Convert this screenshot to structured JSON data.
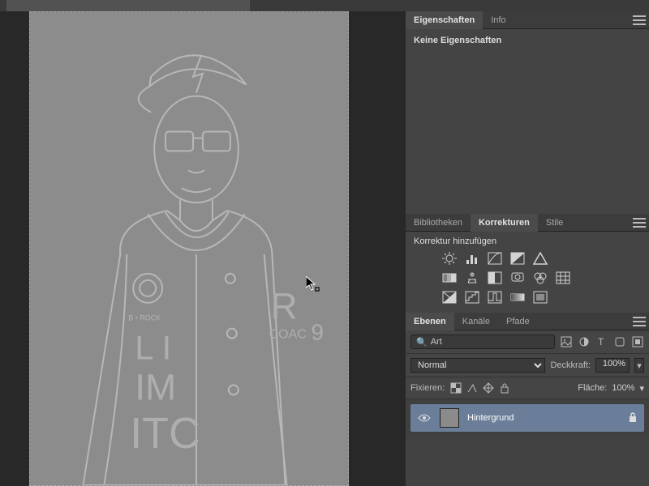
{
  "properties_panel": {
    "tabs": {
      "properties": "Eigenschaften",
      "info": "Info"
    },
    "no_properties": "Keine Eigenschaften"
  },
  "adjustments_panel": {
    "tabs": {
      "libraries": "Bibliotheken",
      "adjustments": "Korrekturen",
      "styles": "Stile"
    },
    "add_adjustment": "Korrektur hinzufügen"
  },
  "layers_panel": {
    "tabs": {
      "layers": "Ebenen",
      "channels": "Kanäle",
      "paths": "Pfade"
    },
    "filter_label": "Art",
    "blend_mode": "Normal",
    "opacity_label": "Deckkraft:",
    "opacity_value": "100%",
    "lock_label": "Fixieren:",
    "fill_label": "Fläche:",
    "fill_value": "100%",
    "layers": [
      {
        "name": "Hintergrund",
        "locked": true,
        "visible": true
      }
    ]
  }
}
